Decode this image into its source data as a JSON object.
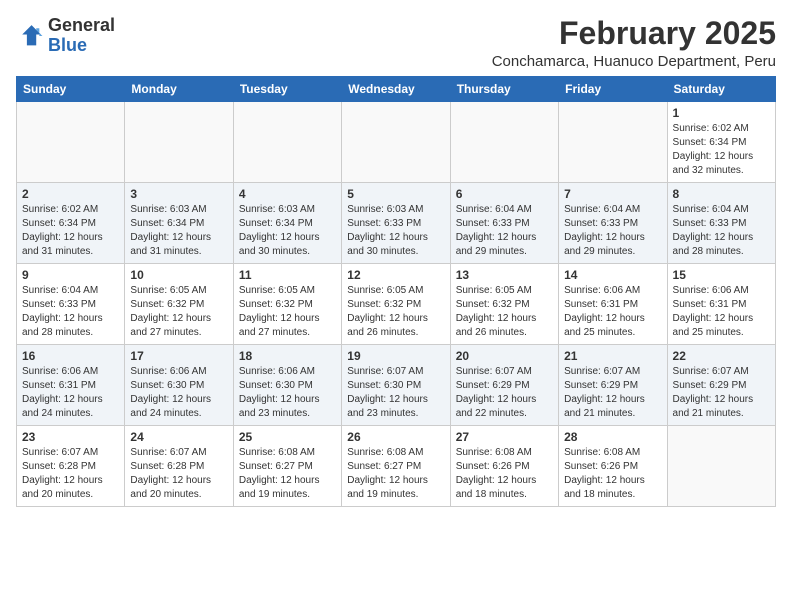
{
  "logo": {
    "general": "General",
    "blue": "Blue"
  },
  "title": "February 2025",
  "location": "Conchamarca, Huanuco Department, Peru",
  "days_of_week": [
    "Sunday",
    "Monday",
    "Tuesday",
    "Wednesday",
    "Thursday",
    "Friday",
    "Saturday"
  ],
  "weeks": [
    [
      {
        "day": "",
        "info": ""
      },
      {
        "day": "",
        "info": ""
      },
      {
        "day": "",
        "info": ""
      },
      {
        "day": "",
        "info": ""
      },
      {
        "day": "",
        "info": ""
      },
      {
        "day": "",
        "info": ""
      },
      {
        "day": "1",
        "info": "Sunrise: 6:02 AM\nSunset: 6:34 PM\nDaylight: 12 hours\nand 32 minutes."
      }
    ],
    [
      {
        "day": "2",
        "info": "Sunrise: 6:02 AM\nSunset: 6:34 PM\nDaylight: 12 hours\nand 31 minutes."
      },
      {
        "day": "3",
        "info": "Sunrise: 6:03 AM\nSunset: 6:34 PM\nDaylight: 12 hours\nand 31 minutes."
      },
      {
        "day": "4",
        "info": "Sunrise: 6:03 AM\nSunset: 6:34 PM\nDaylight: 12 hours\nand 30 minutes."
      },
      {
        "day": "5",
        "info": "Sunrise: 6:03 AM\nSunset: 6:33 PM\nDaylight: 12 hours\nand 30 minutes."
      },
      {
        "day": "6",
        "info": "Sunrise: 6:04 AM\nSunset: 6:33 PM\nDaylight: 12 hours\nand 29 minutes."
      },
      {
        "day": "7",
        "info": "Sunrise: 6:04 AM\nSunset: 6:33 PM\nDaylight: 12 hours\nand 29 minutes."
      },
      {
        "day": "8",
        "info": "Sunrise: 6:04 AM\nSunset: 6:33 PM\nDaylight: 12 hours\nand 28 minutes."
      }
    ],
    [
      {
        "day": "9",
        "info": "Sunrise: 6:04 AM\nSunset: 6:33 PM\nDaylight: 12 hours\nand 28 minutes."
      },
      {
        "day": "10",
        "info": "Sunrise: 6:05 AM\nSunset: 6:32 PM\nDaylight: 12 hours\nand 27 minutes."
      },
      {
        "day": "11",
        "info": "Sunrise: 6:05 AM\nSunset: 6:32 PM\nDaylight: 12 hours\nand 27 minutes."
      },
      {
        "day": "12",
        "info": "Sunrise: 6:05 AM\nSunset: 6:32 PM\nDaylight: 12 hours\nand 26 minutes."
      },
      {
        "day": "13",
        "info": "Sunrise: 6:05 AM\nSunset: 6:32 PM\nDaylight: 12 hours\nand 26 minutes."
      },
      {
        "day": "14",
        "info": "Sunrise: 6:06 AM\nSunset: 6:31 PM\nDaylight: 12 hours\nand 25 minutes."
      },
      {
        "day": "15",
        "info": "Sunrise: 6:06 AM\nSunset: 6:31 PM\nDaylight: 12 hours\nand 25 minutes."
      }
    ],
    [
      {
        "day": "16",
        "info": "Sunrise: 6:06 AM\nSunset: 6:31 PM\nDaylight: 12 hours\nand 24 minutes."
      },
      {
        "day": "17",
        "info": "Sunrise: 6:06 AM\nSunset: 6:30 PM\nDaylight: 12 hours\nand 24 minutes."
      },
      {
        "day": "18",
        "info": "Sunrise: 6:06 AM\nSunset: 6:30 PM\nDaylight: 12 hours\nand 23 minutes."
      },
      {
        "day": "19",
        "info": "Sunrise: 6:07 AM\nSunset: 6:30 PM\nDaylight: 12 hours\nand 23 minutes."
      },
      {
        "day": "20",
        "info": "Sunrise: 6:07 AM\nSunset: 6:29 PM\nDaylight: 12 hours\nand 22 minutes."
      },
      {
        "day": "21",
        "info": "Sunrise: 6:07 AM\nSunset: 6:29 PM\nDaylight: 12 hours\nand 21 minutes."
      },
      {
        "day": "22",
        "info": "Sunrise: 6:07 AM\nSunset: 6:29 PM\nDaylight: 12 hours\nand 21 minutes."
      }
    ],
    [
      {
        "day": "23",
        "info": "Sunrise: 6:07 AM\nSunset: 6:28 PM\nDaylight: 12 hours\nand 20 minutes."
      },
      {
        "day": "24",
        "info": "Sunrise: 6:07 AM\nSunset: 6:28 PM\nDaylight: 12 hours\nand 20 minutes."
      },
      {
        "day": "25",
        "info": "Sunrise: 6:08 AM\nSunset: 6:27 PM\nDaylight: 12 hours\nand 19 minutes."
      },
      {
        "day": "26",
        "info": "Sunrise: 6:08 AM\nSunset: 6:27 PM\nDaylight: 12 hours\nand 19 minutes."
      },
      {
        "day": "27",
        "info": "Sunrise: 6:08 AM\nSunset: 6:26 PM\nDaylight: 12 hours\nand 18 minutes."
      },
      {
        "day": "28",
        "info": "Sunrise: 6:08 AM\nSunset: 6:26 PM\nDaylight: 12 hours\nand 18 minutes."
      },
      {
        "day": "",
        "info": ""
      }
    ]
  ]
}
